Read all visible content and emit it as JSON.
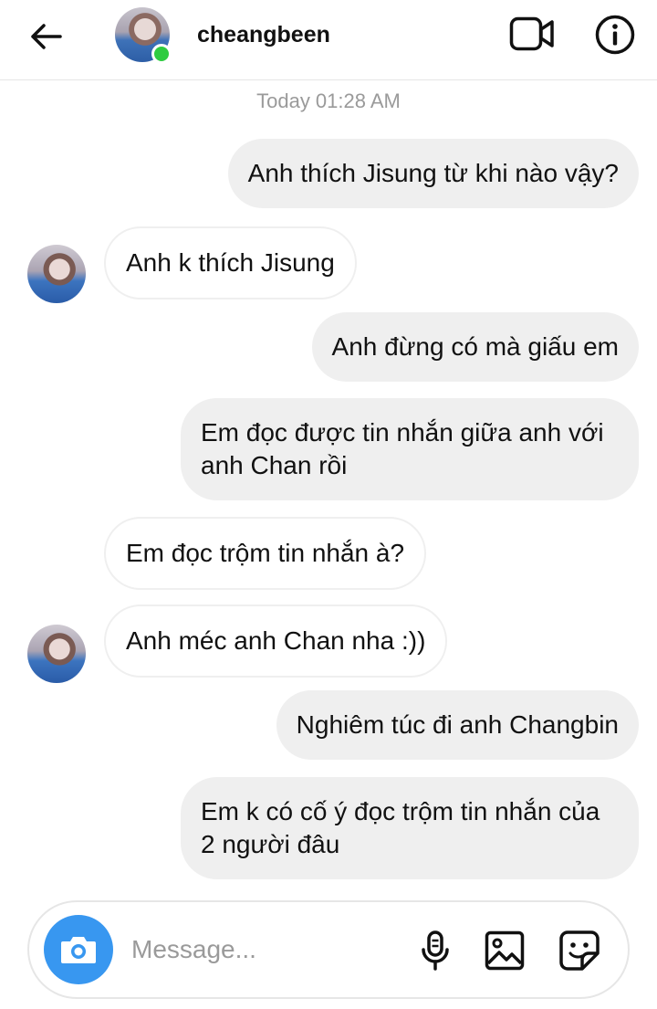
{
  "header": {
    "username": "cheangbeen",
    "online": true,
    "icons": {
      "back": "back-arrow-icon",
      "video": "video-call-icon",
      "info": "info-icon"
    }
  },
  "thread": {
    "timestamp": "Today 01:28 AM",
    "messages": [
      {
        "sender": "me",
        "text": "Anh thích Jisung từ khi nào vậy?"
      },
      {
        "sender": "them",
        "text": "Anh k thích Jisung",
        "avatar": true
      },
      {
        "sender": "me",
        "text": "Anh đừng có mà giấu em"
      },
      {
        "sender": "me",
        "text": "Em đọc được tin nhắn giữa anh với anh Chan rồi"
      },
      {
        "sender": "them",
        "text": "Em đọc trộm tin nhắn à?",
        "avatar": false
      },
      {
        "sender": "them",
        "text": "Anh méc anh Chan nha :))",
        "avatar": true
      },
      {
        "sender": "me",
        "text": "Nghiêm túc đi anh Changbin"
      },
      {
        "sender": "me",
        "text": "Em k có cố ý đọc trộm tin nhắn của 2 người đâu"
      }
    ]
  },
  "composer": {
    "placeholder": "Message...",
    "icons": {
      "camera": "camera-icon",
      "mic": "microphone-icon",
      "gallery": "image-gallery-icon",
      "sticker": "sticker-icon"
    }
  },
  "colors": {
    "accent": "#3897f0",
    "outgoing_bubble": "#efefef",
    "online": "#2ecc40"
  }
}
